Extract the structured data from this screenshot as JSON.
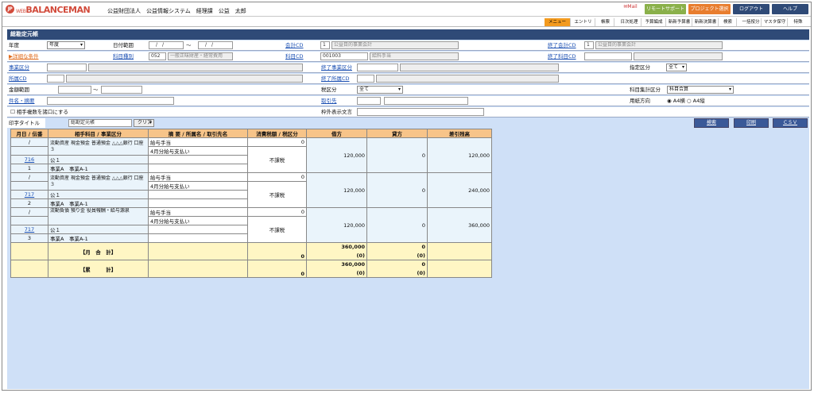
{
  "header": {
    "logo_mark": "JP",
    "logo_prefix": "WEB",
    "logo_text": "BALANCEMAN",
    "org": "公益財団法人　公益情報システム　経理課　公益　太郎",
    "mail_label": "Mail",
    "remote_label": "リモートサポート",
    "project_label": "プロジェクト選択",
    "logout_label": "ログアウト",
    "help_label": "ヘルプ"
  },
  "nav": [
    "メニュー",
    "エントリ",
    "帳票",
    "日次処理",
    "予算編成",
    "新新予算書",
    "新新決算書",
    "検索",
    "一括按分",
    "マスタ保守",
    "特殊"
  ],
  "panel": {
    "title": "総勘定元帳",
    "fiscal_year_label": "年度",
    "fiscal_year_value": "年度",
    "date_range_label": "日付範囲",
    "date_from": "　/　/",
    "tilde": "～",
    "date_to": "　/　/",
    "account_cd_label": "会計CD",
    "account_cd_value": "1",
    "account_cd_name": "公益目的事業会計",
    "end_account_cd_label": "終了会計CD",
    "end_account_cd_value": "1",
    "end_account_cd_name": "公益目的事業会計",
    "detail_cond_label": "▶詳細な条件",
    "subject_type_label": "科目種別",
    "subject_type_value": "052",
    "subject_type_name": "一般正味財産・経常費用",
    "subject_cd_label": "科目CD",
    "subject_cd_value": "001003",
    "subject_cd_name": "給料手当",
    "end_subject_cd_label": "終了科目CD",
    "business_label": "事業区分",
    "end_business_label": "終了事業区分",
    "designation_label": "指定区分",
    "designation_value": "全て",
    "office_label": "所属CD",
    "end_office_label": "終了所属CD",
    "amount_label": "金額範囲",
    "tax_label": "税区分",
    "tax_value": "全て",
    "subject_sum_label": "科目集計区分",
    "subject_sum_value": "科目合算",
    "summary_label": "件名・摘要",
    "partner_label": "取引先",
    "paper_label": "用紙方向",
    "paper_a4_landscape": "A4横",
    "paper_a4_portrait": "A4縦",
    "multi_partner_label": "相手複数を諸口にする",
    "outside_label": "枠外表示文言",
    "print_title_label": "印字タイトル",
    "print_title_value": "総勘定元帳",
    "clear_label": "クリア",
    "search_btn": "検索",
    "print_btn": "印刷",
    "csv_btn": "ＣＳＶ"
  },
  "table": {
    "headers": [
      "月日 / 伝番",
      "相手科目 / 事業区分",
      "摘 要 / 所属名 / 取引先名",
      "消費税額 / 税区分",
      "借方",
      "貸方",
      "差引残高"
    ],
    "entries": [
      {
        "date": "/",
        "voucher": "716",
        "line": "1",
        "counter": "流動資産 現金預金 普通預金 △△△銀行 口座３",
        "dept": "公１",
        "biz": "事業A　事業A-1",
        "summary1": "給与手当",
        "summary2": "4月分給与支払い",
        "tax": "0",
        "taxcls": "不課税",
        "debit": "120,000",
        "credit": "0",
        "balance": "120,000"
      },
      {
        "date": "/",
        "voucher": "717",
        "line": "2",
        "counter": "流動資産 現金預金 普通預金 △△△銀行 口座３",
        "dept": "公１",
        "biz": "事業A　事業A-1",
        "summary1": "給与手当",
        "summary2": "4月分給与支払い",
        "tax": "0",
        "taxcls": "不課税",
        "debit": "120,000",
        "credit": "0",
        "balance": "240,000"
      },
      {
        "date": "/",
        "voucher": "717",
        "line": "3",
        "counter": "流動負債 預り金 役員報酬・給与源泉",
        "dept": "公１",
        "biz": "事業A　事業A-1",
        "summary1": "給与手当",
        "summary2": "4月分給与支払い",
        "tax": "0",
        "taxcls": "不課税",
        "debit": "120,000",
        "credit": "0",
        "balance": "360,000"
      }
    ],
    "month_total": {
      "label": "【月　合　計】",
      "tax": "0",
      "debit": "360,000",
      "debit_sub": "(0)",
      "credit": "0",
      "credit_sub": "(0)"
    },
    "cum_total": {
      "label": "【累　　　計】",
      "tax": "0",
      "debit": "360,000",
      "debit_sub": "(0)",
      "credit": "0",
      "credit_sub": "(0)"
    }
  },
  "colors": {
    "title_bar": "#2f4a77",
    "panel_bg": "#cfe0f7",
    "header_orange": "#f7c489",
    "total_yellow": "#fff6c4",
    "active_nav": "#f39a1e"
  }
}
